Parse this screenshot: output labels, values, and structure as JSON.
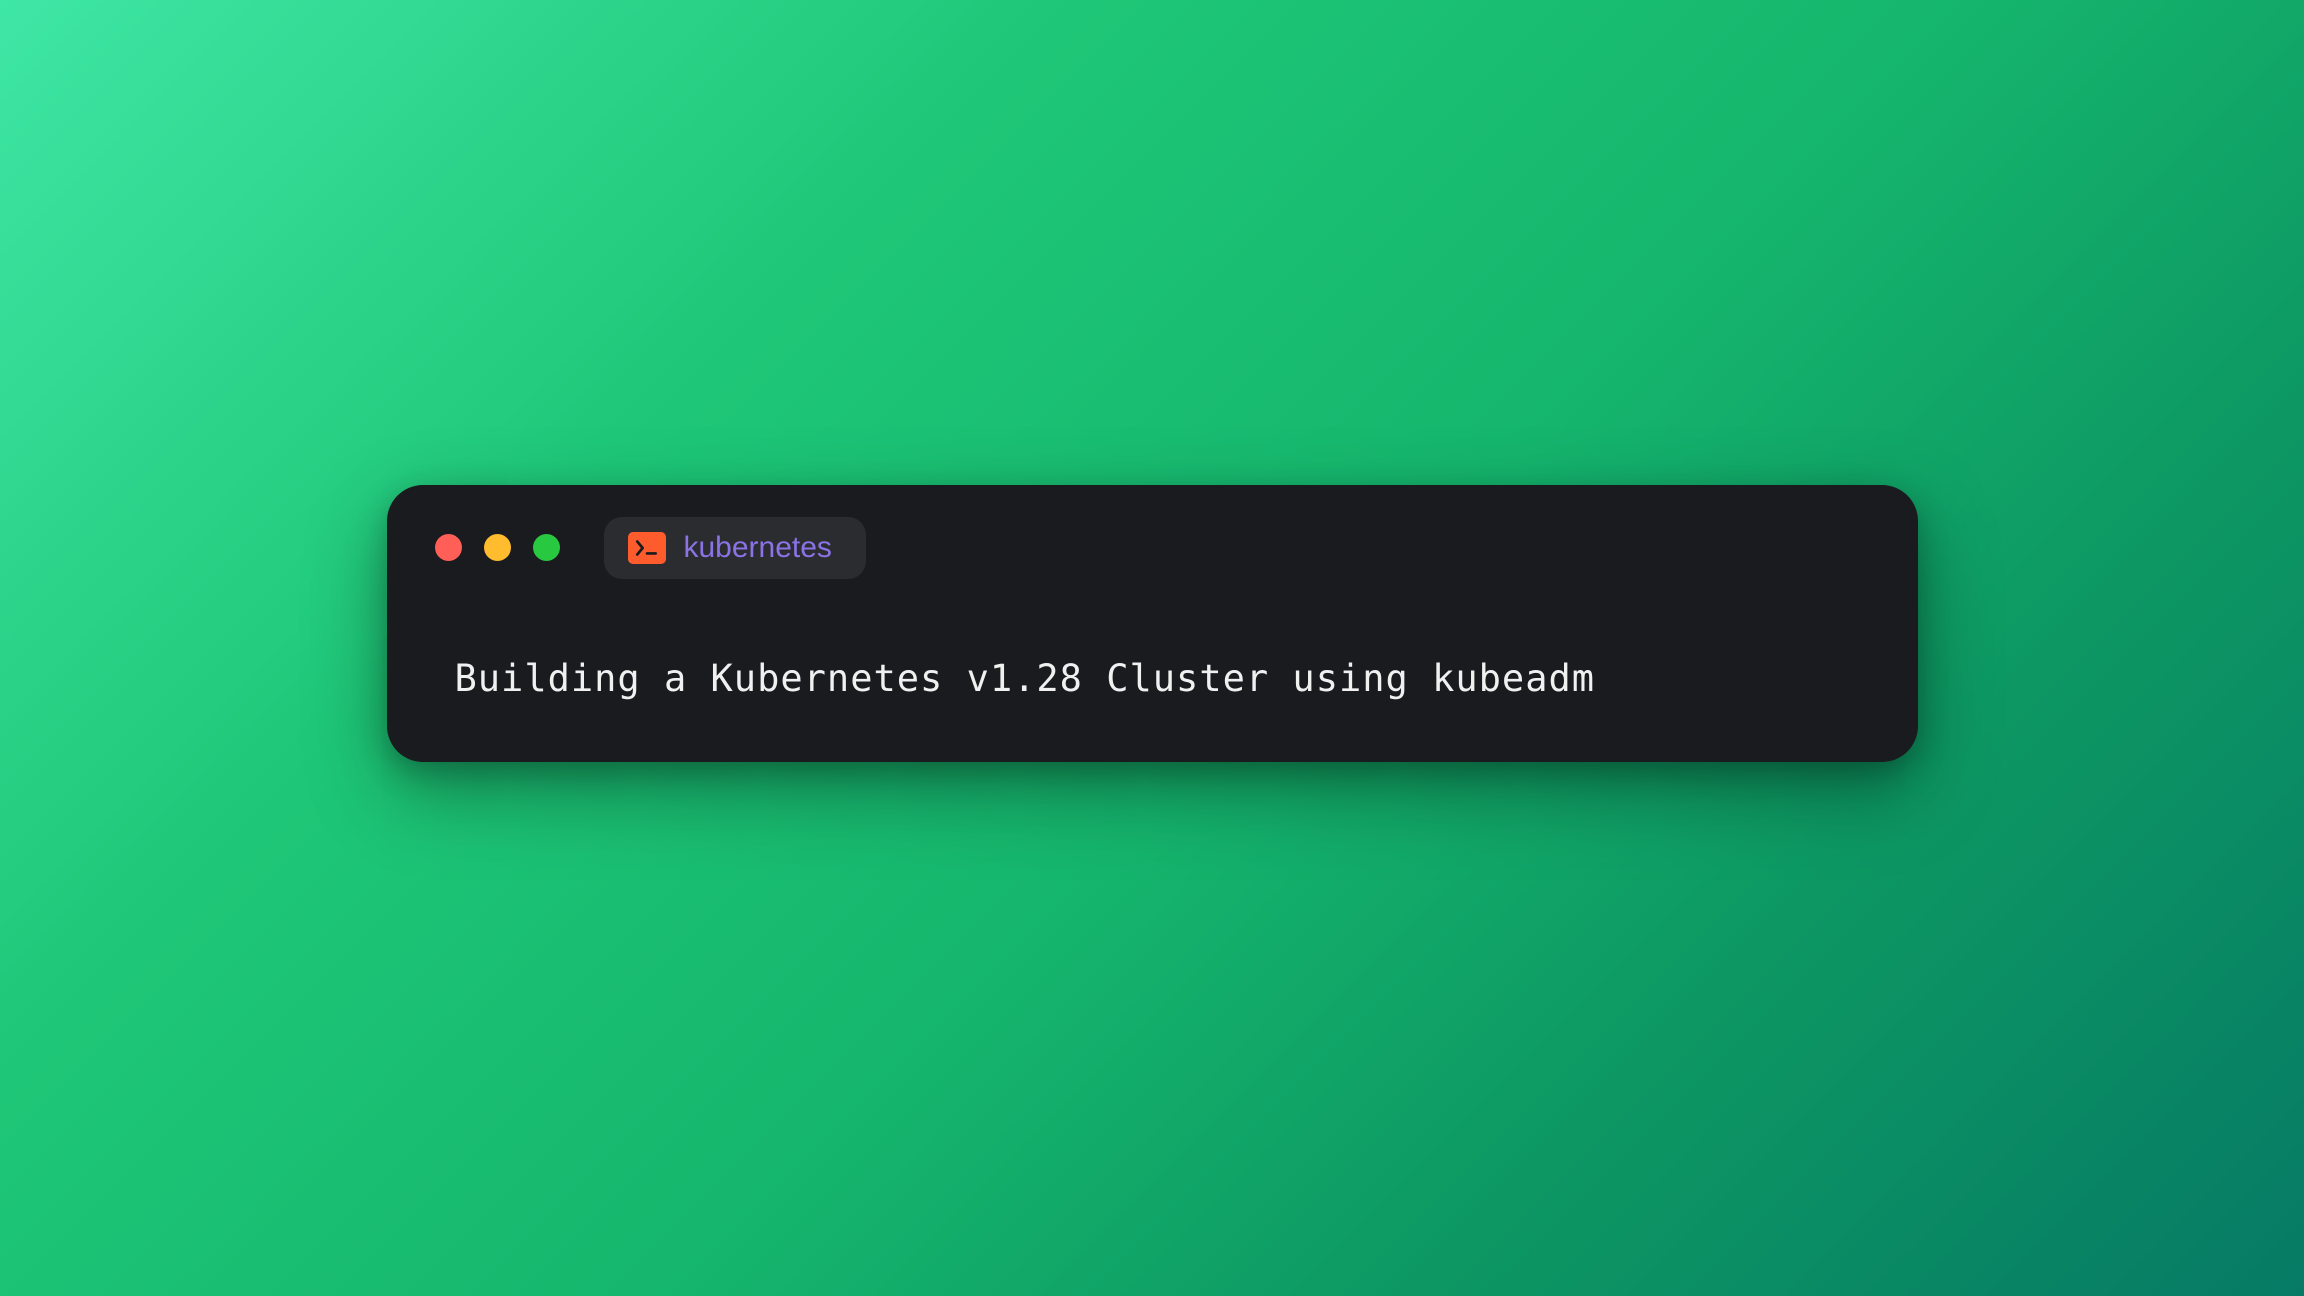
{
  "window": {
    "tab_label": "kubernetes"
  },
  "content": {
    "title_text": "Building a Kubernetes v1.28 Cluster using kubeadm"
  },
  "colors": {
    "traffic_red": "#ff5f57",
    "traffic_yellow": "#febc2e",
    "traffic_green": "#28c840",
    "terminal_bg": "#1a1b1e",
    "tab_bg": "#2a2c30",
    "tab_text": "#8b72e5",
    "icon_bg": "#ff5c2e"
  }
}
